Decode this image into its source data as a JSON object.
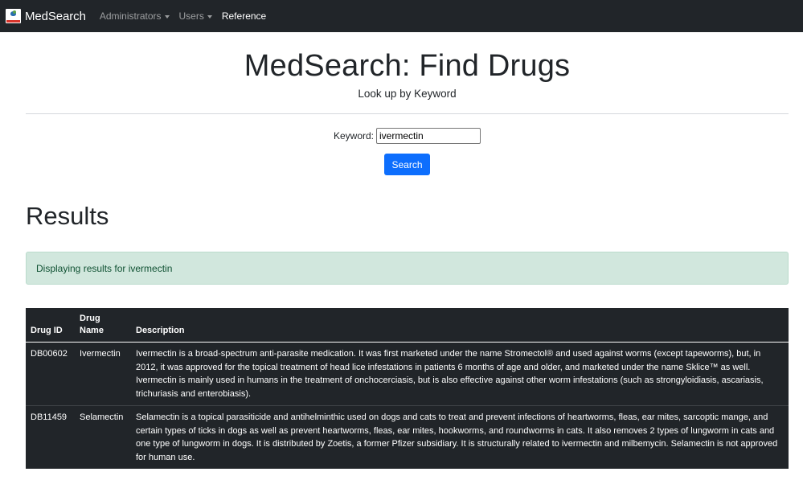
{
  "navbar": {
    "brand": "MedSearch",
    "items": [
      {
        "label": "Administrators",
        "dropdown": true
      },
      {
        "label": "Users",
        "dropdown": true
      },
      {
        "label": "Reference",
        "dropdown": false
      }
    ]
  },
  "header": {
    "title": "MedSearch: Find Drugs",
    "subtitle": "Look up by Keyword"
  },
  "search": {
    "label": "Keyword:",
    "value": "ivermectin",
    "button": "Search"
  },
  "results": {
    "title": "Results",
    "alert": "Displaying results for ivermectin",
    "columns": [
      "Drug ID",
      "Drug Name",
      "Description"
    ],
    "rows": [
      {
        "id": "DB00602",
        "name": "Ivermectin",
        "description": "Ivermectin is a broad-spectrum anti-parasite medication. It was first marketed under the name Stromectol® and used against worms (except tapeworms), but, in 2012, it was approved for the topical treatment of head lice infestations in patients 6 months of age and older, and marketed under the name Sklice™ as well. Ivermectin is mainly used in humans in the treatment of onchocerciasis, but is also effective against other worm infestations (such as strongyloidiasis, ascariasis, trichuriasis and enterobiasis)."
      },
      {
        "id": "DB11459",
        "name": "Selamectin",
        "description": "Selamectin is a topical parasiticide and antihelminthic used on dogs and cats to treat and prevent infections of heartworms, fleas, ear mites, sarcoptic mange, and certain types of ticks in dogs as well as prevent heartworms, fleas, ear mites, hookworms, and roundworms in cats. It also removes 2 types of lungworm in cats and one type of lungworm in dogs. It is distributed by Zoetis, a former Pfizer subsidiary. It is structurally related to ivermectin and milbemycin. Selamectin is not approved for human use."
      }
    ]
  },
  "colors": {
    "navbar_bg": "#212529",
    "primary": "#0d6efd",
    "alert_bg": "#d1e7dd",
    "alert_text": "#0f5132"
  }
}
